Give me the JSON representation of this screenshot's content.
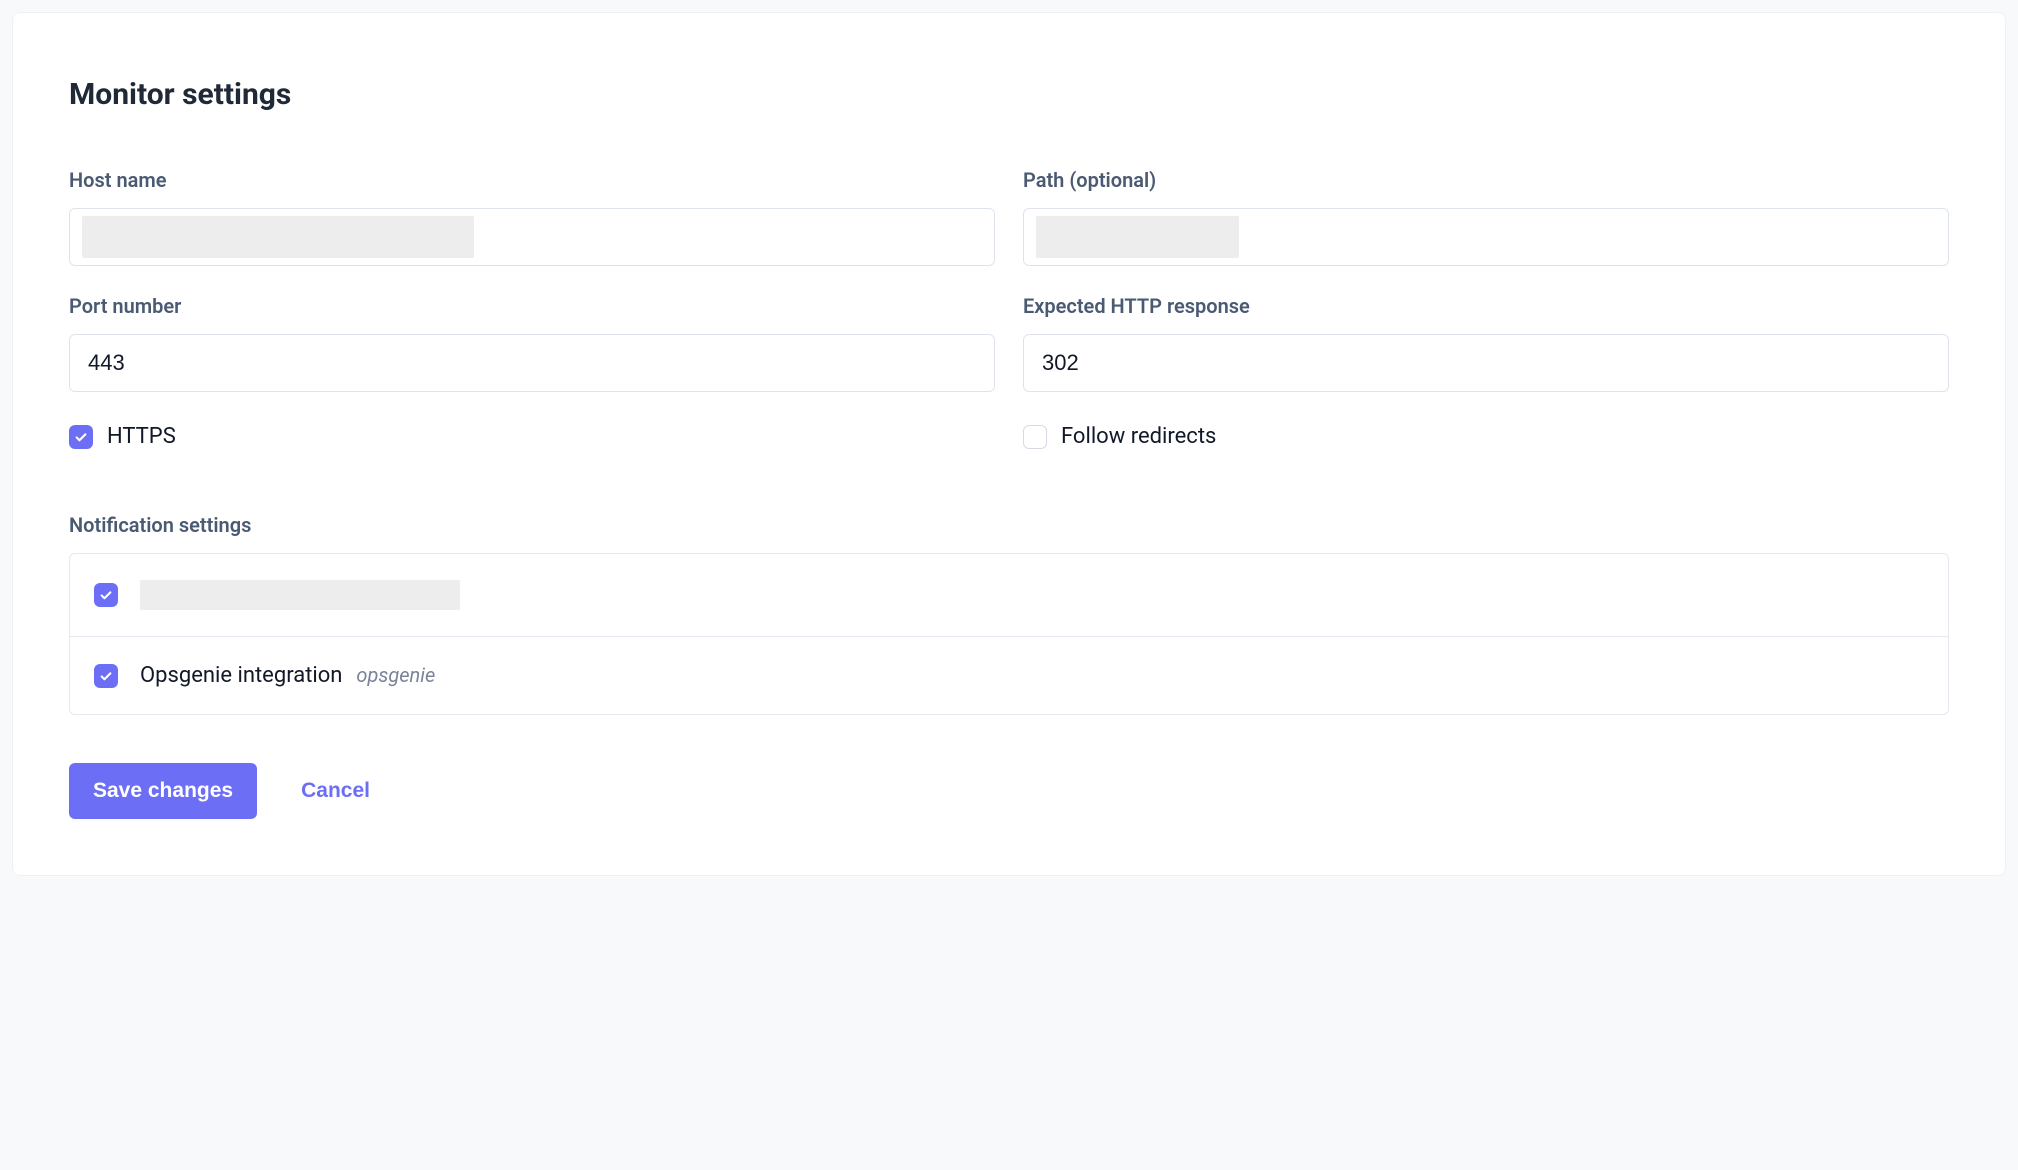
{
  "page": {
    "title": "Monitor settings"
  },
  "fields": {
    "host_name": {
      "label": "Host name",
      "value": ""
    },
    "path": {
      "label": "Path (optional)",
      "value": ""
    },
    "port_number": {
      "label": "Port number",
      "value": "443"
    },
    "expected_response": {
      "label": "Expected HTTP response",
      "value": "302"
    },
    "https": {
      "label": "HTTPS",
      "checked": true
    },
    "follow_redirects": {
      "label": "Follow redirects",
      "checked": false
    }
  },
  "notifications": {
    "label": "Notification settings",
    "items": [
      {
        "checked": true,
        "label": "",
        "sub": ""
      },
      {
        "checked": true,
        "label": "Opsgenie integration",
        "sub": "opsgenie"
      }
    ]
  },
  "buttons": {
    "save": "Save changes",
    "cancel": "Cancel"
  },
  "colors": {
    "accent": "#6c6ff5",
    "label": "#4b5a73",
    "text": "#111827",
    "border": "#dfe3eb"
  }
}
